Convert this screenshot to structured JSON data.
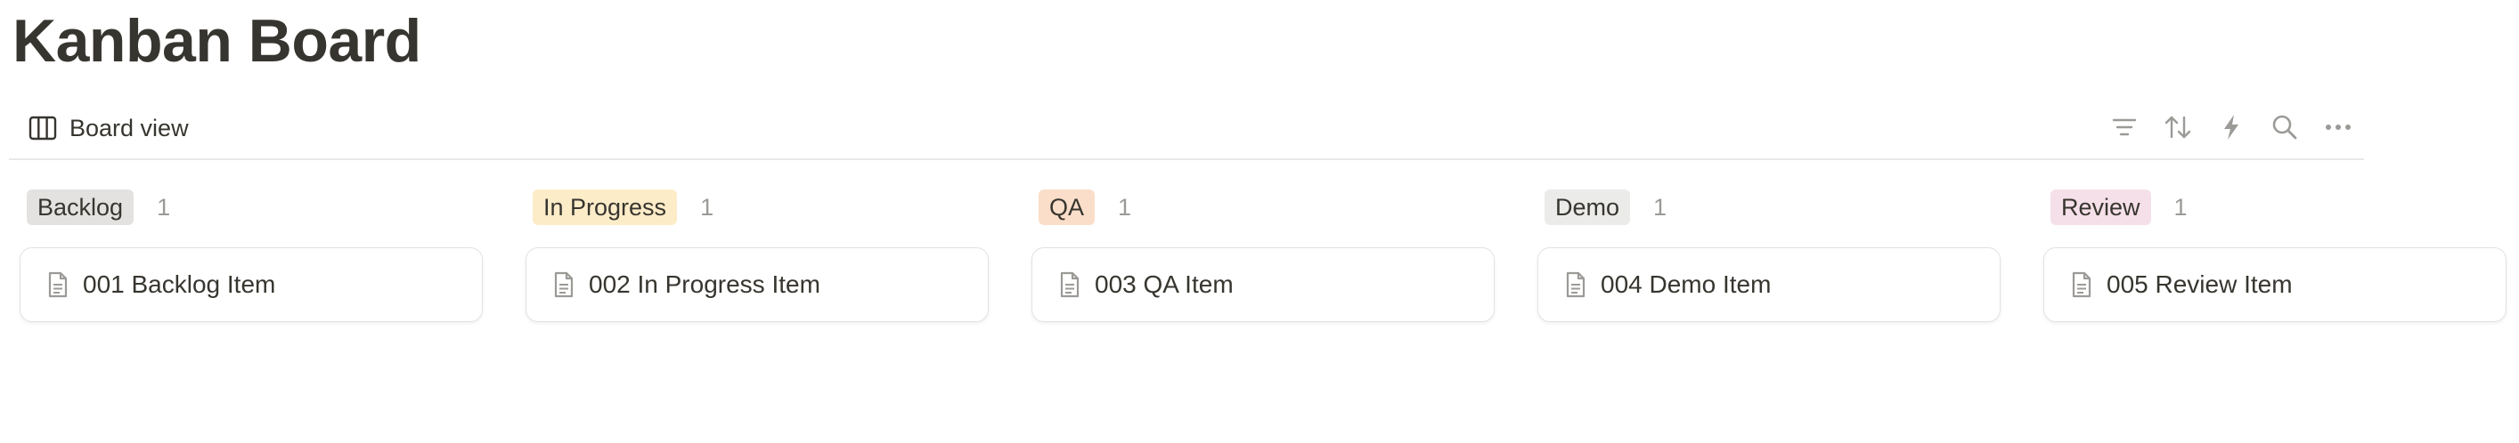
{
  "page": {
    "title": "Kanban Board"
  },
  "toolbar": {
    "view_label": "Board view",
    "view_icon": "board-view-icon",
    "tools": [
      {
        "name": "filter-icon"
      },
      {
        "name": "sort-icon"
      },
      {
        "name": "automation-icon"
      },
      {
        "name": "search-icon"
      },
      {
        "name": "more-icon"
      }
    ]
  },
  "board": {
    "columns": [
      {
        "label": "Backlog",
        "count": "1",
        "color": "#e3e2e0",
        "cards": [
          {
            "title": "001 Backlog Item",
            "icon": "page-icon"
          }
        ]
      },
      {
        "label": "In Progress",
        "count": "1",
        "color": "#fdecc8",
        "cards": [
          {
            "title": "002 In Progress Item",
            "icon": "page-icon"
          }
        ]
      },
      {
        "label": "QA",
        "count": "1",
        "color": "#fadec9",
        "cards": [
          {
            "title": "003 QA Item",
            "icon": "page-icon"
          }
        ]
      },
      {
        "label": "Demo",
        "count": "1",
        "color": "#ebebea",
        "cards": [
          {
            "title": "004 Demo Item",
            "icon": "page-icon"
          }
        ]
      },
      {
        "label": "Review",
        "count": "1",
        "color": "#f5e0e9",
        "cards": [
          {
            "title": "005 Review Item",
            "icon": "page-icon"
          }
        ]
      }
    ]
  }
}
